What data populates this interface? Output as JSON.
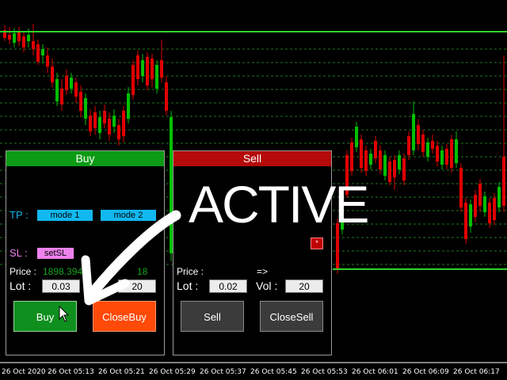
{
  "colors": {
    "bull": "#00c000",
    "bear": "#e00000",
    "grid": "#1f7a1f",
    "level": "#2bd42b"
  },
  "x_axis": {
    "labels": [
      "26 Oct 2020",
      "26 Oct 05:13",
      "26 Oct 05:21",
      "26 Oct 05:29",
      "26 Oct 05:37",
      "26 Oct 05:45",
      "26 Oct 05:53",
      "26 Oct 06:01",
      "26 Oct 06:09",
      "26 Oct 06:17"
    ]
  },
  "overlay": {
    "active_text": "ACTIVE",
    "star_label": "*"
  },
  "buy_panel": {
    "title": "Buy",
    "tp_label": "TP :",
    "mode1_label": "mode 1",
    "mode2_label": "mode 2",
    "sl_label": "SL :",
    "setsl_label": "setSL",
    "price_label": "Price :",
    "price_value": "1898.394",
    "price_right": "18",
    "lot_label": "Lot :",
    "lot_value": "0.03",
    "vol_value": "20",
    "buy_label": "Buy",
    "closebuy_label": "CloseBuy"
  },
  "sell_panel": {
    "title": "Sell",
    "price_label": "Price :",
    "arrow_label": "=>",
    "lot_label": "Lot :",
    "lot_value": "0.02",
    "vol_label": "Vol :",
    "vol_value": "20",
    "sell_label": "Sell",
    "closesell_label": "CloseSell"
  }
}
